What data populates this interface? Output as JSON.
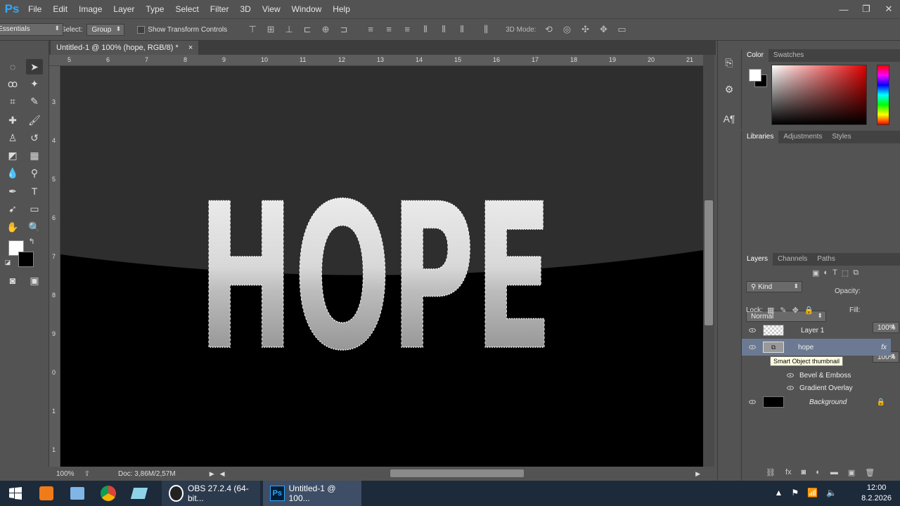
{
  "menu": {
    "logo": "Ps",
    "items": [
      "File",
      "Edit",
      "Image",
      "Layer",
      "Type",
      "Select",
      "Filter",
      "3D",
      "View",
      "Window",
      "Help"
    ]
  },
  "window_controls": {
    "minimize": "—",
    "restore": "❐",
    "close": "✕"
  },
  "options_bar": {
    "auto_select_label": "Auto-Select:",
    "auto_select_value": "Group",
    "show_transform_label": "Show Transform Controls",
    "mode_3d_label": "3D Mode:",
    "workspace": "Essentials"
  },
  "document": {
    "tab_title": "Untitled-1 @ 100% (hope, RGB/8) *",
    "tab_close": "×",
    "ruler_top": [
      "5",
      "6",
      "7",
      "8",
      "9",
      "10",
      "11",
      "12",
      "13",
      "14",
      "15",
      "16",
      "17",
      "18",
      "19",
      "20",
      "21"
    ],
    "ruler_left": [
      "3",
      "4",
      "5",
      "6",
      "7",
      "8",
      "9",
      "0",
      "1",
      "1"
    ],
    "canvas_text": "HOPE",
    "zoom": "100%",
    "doc_size": "Doc: 3,86M/2,57M"
  },
  "color_panel": {
    "tabs": [
      "Color",
      "Swatches"
    ],
    "active_tab": "Color",
    "foreground": "#ffffff",
    "background": "#000000",
    "hue": "#ff0000"
  },
  "libraries_panel": {
    "tabs": [
      "Libraries",
      "Adjustments",
      "Styles"
    ]
  },
  "layers_panel": {
    "tabs": [
      "Layers",
      "Channels",
      "Paths"
    ],
    "filter_kind": "Kind",
    "blend_mode": "Normal",
    "opacity_label": "Opacity:",
    "opacity_value": "100%",
    "lock_label": "Lock:",
    "fill_label": "Fill:",
    "fill_value": "100%",
    "layers": [
      {
        "name": "Layer 1"
      },
      {
        "name": "hope",
        "fx": "fx",
        "tooltip": "Smart Object thumbnail"
      },
      {
        "name": "Background"
      }
    ],
    "effects": [
      "Bevel & Emboss",
      "Gradient Overlay"
    ]
  },
  "taskbar": {
    "obs_label": "OBS 27.2.4 (64-bit...",
    "ps_label": "Untitled-1 @ 100...",
    "time": "12:00",
    "date": "8.2.2026"
  }
}
